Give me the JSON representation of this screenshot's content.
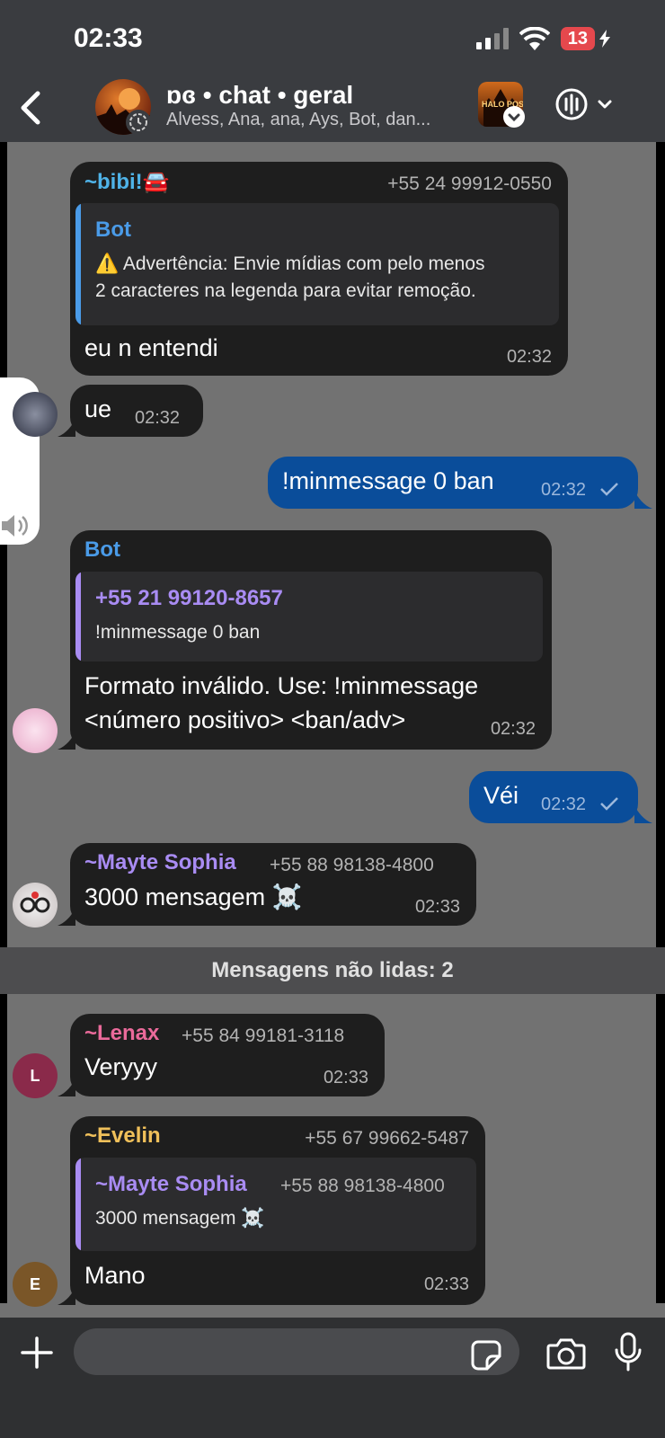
{
  "status_bar": {
    "time": "02:33",
    "battery": "13"
  },
  "header": {
    "title": "ɒɞ • chat • geral",
    "subtitle": "Alvess, Ana, ana, Ays, Bot, dan...",
    "community_logo_text": "HALO POSTS"
  },
  "messages": [
    {
      "sender": "~bibi!🚘",
      "phone": "+55 24 99912-0550",
      "quote_name": "Bot",
      "quote_text_1": "⚠️ Advertência: Envie mídias com pelo menos",
      "quote_text_2": "2 caracteres na legenda para evitar remoção.",
      "text": "eu n entendi",
      "time": "02:32"
    },
    {
      "text": "ue",
      "time": "02:32"
    },
    {
      "text": "!minmessage 0 ban",
      "time": "02:32",
      "outgoing": true
    },
    {
      "sender": "Bot",
      "quote_name": "+55 21 99120-8657",
      "quote_text": "!minmessage 0 ban",
      "text_1": "Formato inválido. Use: !minmessage",
      "text_2": "<número positivo> <ban/adv>",
      "time": "02:32"
    },
    {
      "text": "Véi",
      "time": "02:32",
      "outgoing": true
    },
    {
      "sender": "~Mayte Sophia",
      "phone": "+55 88 98138-4800",
      "text": "3000 mensagem ☠️",
      "time": "02:33"
    },
    {
      "sender": "~Lenax",
      "phone": "+55 84 99181-3118",
      "text": "Veryyy",
      "time": "02:33",
      "avatar_letter": "L"
    },
    {
      "sender": "~Evelin",
      "phone": "+55 67 99662-5487",
      "quote_name": "~Mayte Sophia",
      "quote_phone": "+55 88 98138-4800",
      "quote_text": "3000 mensagem ☠️",
      "text": "Mano",
      "time": "02:33",
      "avatar_letter": "E"
    }
  ],
  "unread_label": "Mensagens não lidas: 2",
  "colors": {
    "bibi": "#4fb3e8",
    "bot": "#4a9be8",
    "mayte": "#a98cf3",
    "lenax": "#ea6a9a",
    "evelin": "#f0c05a"
  }
}
